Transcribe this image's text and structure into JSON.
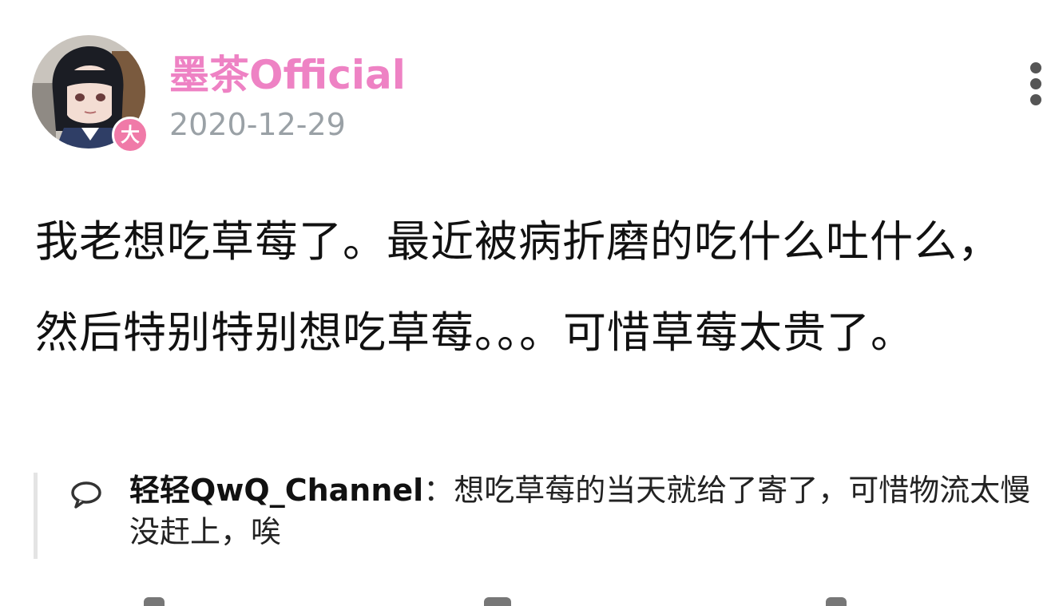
{
  "post": {
    "author": {
      "name": "墨茶Official",
      "badge": "大",
      "name_color": "#ee82c4",
      "badge_color": "#f07aa8"
    },
    "date": "2020-12-29",
    "content": "我老想吃草莓了。最近被病折磨的吃什么吐什么，然后特别特别想吃草莓。。。可惜草莓太贵了。"
  },
  "comment": {
    "author": "轻轻QwQ_Channel",
    "separator": "：",
    "text": "想吃草莓的当天就给了寄了，可惜物流太慢没赶上，唉"
  },
  "icons": {
    "more": "more-vertical-icon",
    "comment": "comment-bubble-icon"
  }
}
